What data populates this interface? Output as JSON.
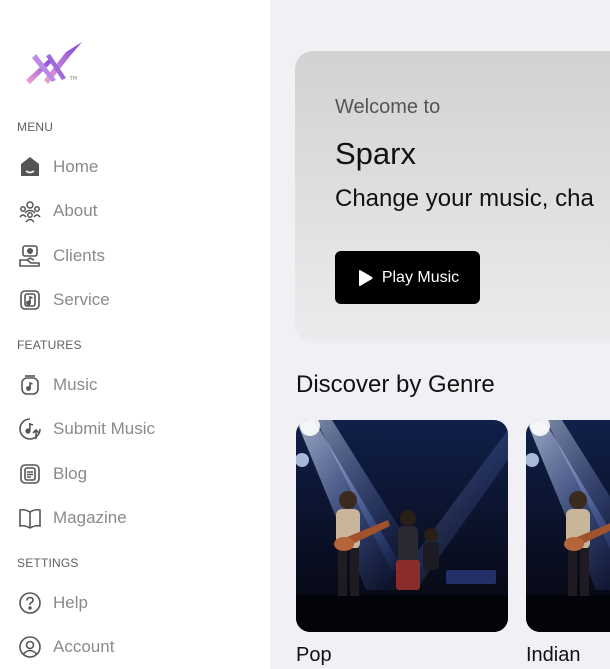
{
  "sidebar": {
    "sections": {
      "menu": "MENU",
      "features": "FEATURES",
      "settings": "SETTINGS"
    },
    "items": [
      {
        "label": "Home",
        "icon": "home-icon"
      },
      {
        "label": "About",
        "icon": "people-icon"
      },
      {
        "label": "Clients",
        "icon": "client-icon"
      },
      {
        "label": "Service",
        "icon": "service-icon"
      },
      {
        "label": "Music",
        "icon": "music-icon"
      },
      {
        "label": "Submit Music",
        "icon": "submit-music-icon"
      },
      {
        "label": "Blog",
        "icon": "blog-icon"
      },
      {
        "label": "Magazine",
        "icon": "magazine-icon"
      },
      {
        "label": "Help",
        "icon": "help-icon"
      },
      {
        "label": "Account",
        "icon": "account-icon"
      }
    ]
  },
  "hero": {
    "welcome": "Welcome to",
    "brand": "Sparx",
    "tagline": "Change your music, cha",
    "play_label": "Play Music"
  },
  "discover": {
    "title": "Discover by Genre",
    "genres": [
      {
        "label": "Pop"
      },
      {
        "label": "Indian"
      }
    ]
  },
  "colors": {
    "accent": "#8a2be2",
    "button_bg": "#000000",
    "sidebar_bg": "#ffffff",
    "main_bg": "#f1f1f5"
  }
}
